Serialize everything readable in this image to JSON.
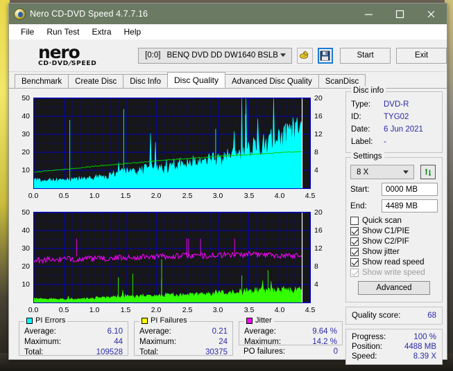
{
  "window": {
    "title": "Nero CD-DVD Speed 4.7.7.16",
    "icon": "nero-disc-icon",
    "minimize": "minimize-icon",
    "maximize": "maximize-icon",
    "close": "close-icon"
  },
  "menu": {
    "items": [
      "File",
      "Run Test",
      "Extra",
      "Help"
    ]
  },
  "brand": {
    "line1": "nero",
    "line2_a": "CD·DVD",
    "line2_b": "SPEED"
  },
  "toolbar": {
    "drive_slot": "[0:0]",
    "drive_name": "BENQ DVD DD DW1640 BSLB",
    "eject_icon": "eject-disc-icon",
    "save_icon": "save-floppy-icon",
    "start_label": "Start",
    "exit_label": "Exit"
  },
  "tabs": [
    {
      "label": "Benchmark",
      "active": false
    },
    {
      "label": "Create Disc",
      "active": false
    },
    {
      "label": "Disc Info",
      "active": false
    },
    {
      "label": "Disc Quality",
      "active": true
    },
    {
      "label": "Advanced Disc Quality",
      "active": false
    },
    {
      "label": "ScanDisc",
      "active": false
    }
  ],
  "disc_info": {
    "legend": "Disc info",
    "rows": [
      {
        "key": "Type:",
        "value": "DVD-R"
      },
      {
        "key": "ID:",
        "value": "TYG02"
      },
      {
        "key": "Date:",
        "value": "6 Jun 2021"
      },
      {
        "key": "Label:",
        "value": "-"
      }
    ]
  },
  "settings": {
    "legend": "Settings",
    "speed": "8 X",
    "refresh_icon": "refresh-arrows-icon",
    "start_label": "Start:",
    "start_value": "0000 MB",
    "end_label": "End:",
    "end_value": "4489 MB",
    "checkboxes": [
      {
        "label": "Quick scan",
        "checked": false,
        "disabled": false
      },
      {
        "label": "Show C1/PIE",
        "checked": true,
        "disabled": false
      },
      {
        "label": "Show C2/PIF",
        "checked": true,
        "disabled": false
      },
      {
        "label": "Show jitter",
        "checked": true,
        "disabled": false
      },
      {
        "label": "Show read speed",
        "checked": true,
        "disabled": false
      },
      {
        "label": "Show write speed",
        "checked": true,
        "disabled": true
      }
    ],
    "advanced_label": "Advanced"
  },
  "quality": {
    "label": "Quality score:",
    "value": "68"
  },
  "progress": {
    "rows": [
      {
        "key": "Progress:",
        "value": "100 %"
      },
      {
        "key": "Position:",
        "value": "4488 MB"
      },
      {
        "key": "Speed:",
        "value": "8.39 X"
      }
    ]
  },
  "stats": {
    "pi_errors": {
      "legend": "PI Errors",
      "color": "#00ffff",
      "rows": [
        {
          "key": "Average:",
          "value": "6.10"
        },
        {
          "key": "Maximum:",
          "value": "44"
        },
        {
          "key": "Total:",
          "value": "109528"
        }
      ]
    },
    "pi_failures": {
      "legend": "PI Failures",
      "color": "#ffff00",
      "rows": [
        {
          "key": "Average:",
          "value": "0.21"
        },
        {
          "key": "Maximum:",
          "value": "24"
        },
        {
          "key": "Total:",
          "value": "30375"
        }
      ]
    },
    "jitter": {
      "legend": "Jitter",
      "color": "#ff00ff",
      "rows": [
        {
          "key": "Average:",
          "value": "9.64 %"
        },
        {
          "key": "Maximum:",
          "value": "14.2 %"
        }
      ]
    },
    "po_failures": {
      "key": "PO failures:",
      "value": "0"
    }
  },
  "chart_data": [
    {
      "type": "area",
      "name": "PI Errors scan graph",
      "title": "",
      "xlabel": "",
      "ylabel": "",
      "xticks": [
        "0.0",
        "0.5",
        "1.0",
        "1.5",
        "2.0",
        "2.5",
        "3.0",
        "3.5",
        "4.0",
        "4.5"
      ],
      "xlim": [
        0.0,
        4.5
      ],
      "yticks_left": [
        "10",
        "20",
        "30",
        "40",
        "50"
      ],
      "ylim_left": [
        0,
        50
      ],
      "yticks_right": [
        "4",
        "8",
        "12",
        "16",
        "20"
      ],
      "ylim_right": [
        0,
        20
      ],
      "grid": true,
      "background": "#171717",
      "grid_color": "#0000c8",
      "data_end_x": 4.37,
      "series": [
        {
          "name": "PI Errors",
          "color": "#00ffff",
          "axis": "left",
          "x": [
            0.0,
            0.1,
            0.2,
            0.3,
            0.4,
            0.5,
            0.6,
            0.7,
            0.8,
            0.9,
            1.0,
            1.1,
            1.2,
            1.3,
            1.4,
            1.5,
            1.6,
            1.7,
            1.8,
            1.9,
            2.0,
            2.1,
            2.2,
            2.3,
            2.4,
            2.5,
            2.6,
            2.7,
            2.8,
            2.9,
            3.0,
            3.1,
            3.2,
            3.3,
            3.4,
            3.5,
            3.6,
            3.7,
            3.8,
            3.9,
            4.0,
            4.1,
            4.2,
            4.3,
            4.37
          ],
          "values": [
            6.0,
            4.5,
            4.2,
            4.6,
            4.4,
            4.8,
            4.7,
            4.9,
            5.2,
            5.4,
            6.0,
            6.6,
            7.0,
            7.6,
            8.4,
            9.0,
            9.6,
            10.0,
            10.4,
            10.8,
            11.2,
            11.6,
            12.0,
            12.6,
            13.0,
            13.6,
            14.2,
            15.0,
            15.6,
            16.2,
            17.0,
            17.8,
            18.6,
            19.4,
            20.2,
            21.2,
            22.4,
            23.6,
            25.0,
            26.6,
            28.0,
            29.6,
            31.0,
            33.0,
            34.0
          ],
          "peaks": [
            44,
            41,
            38,
            36,
            35,
            33
          ]
        },
        {
          "name": "Read speed",
          "color": "#00cc00",
          "axis": "right",
          "x": [
            0.0,
            0.5,
            1.0,
            1.5,
            2.0,
            2.5,
            3.0,
            3.5,
            4.0,
            4.37
          ],
          "values": [
            3.6,
            4.2,
            4.9,
            5.5,
            6.1,
            6.6,
            7.1,
            7.5,
            7.9,
            8.2
          ]
        }
      ]
    },
    {
      "type": "area",
      "name": "PI Failures and Jitter scan graph",
      "title": "",
      "xlabel": "",
      "ylabel": "",
      "xticks": [
        "0.0",
        "0.5",
        "1.0",
        "1.5",
        "2.0",
        "2.5",
        "3.0",
        "3.5",
        "4.0",
        "4.5"
      ],
      "xlim": [
        0.0,
        4.5
      ],
      "yticks_left": [
        "10",
        "20",
        "30",
        "40",
        "50"
      ],
      "ylim_left": [
        0,
        50
      ],
      "yticks_right": [
        "4",
        "8",
        "12",
        "16",
        "20"
      ],
      "ylim_right": [
        0,
        20
      ],
      "grid": true,
      "background": "#171717",
      "grid_color": "#0000c8",
      "data_end_x": 4.37,
      "series": [
        {
          "name": "PI Failures",
          "color": "#33ff00",
          "axis": "left",
          "x": [
            0.0,
            0.25,
            0.5,
            0.75,
            1.0,
            1.25,
            1.5,
            1.75,
            2.0,
            2.25,
            2.5,
            2.75,
            3.0,
            3.25,
            3.5,
            3.75,
            4.0,
            4.25,
            4.37
          ],
          "values": [
            2.0,
            1.8,
            1.9,
            2.0,
            2.4,
            3.0,
            3.4,
            3.6,
            4.0,
            4.2,
            4.4,
            4.8,
            5.2,
            5.6,
            6.2,
            6.6,
            6.8,
            7.0,
            7.2
          ],
          "peaks": [
            24,
            18,
            16,
            15,
            14,
            13
          ]
        },
        {
          "name": "Jitter",
          "color": "#ff00ff",
          "axis": "right",
          "x": [
            0.0,
            0.25,
            0.5,
            0.75,
            1.0,
            1.25,
            1.5,
            1.75,
            2.0,
            2.25,
            2.5,
            2.75,
            3.0,
            3.25,
            3.5,
            3.75,
            4.0,
            4.25,
            4.37
          ],
          "values": [
            9.3,
            9.5,
            9.6,
            9.7,
            9.7,
            9.8,
            10.0,
            10.1,
            10.2,
            10.3,
            10.4,
            10.4,
            10.5,
            10.6,
            10.7,
            10.6,
            10.5,
            10.4,
            10.6
          ],
          "max": 14.2
        }
      ]
    }
  ]
}
